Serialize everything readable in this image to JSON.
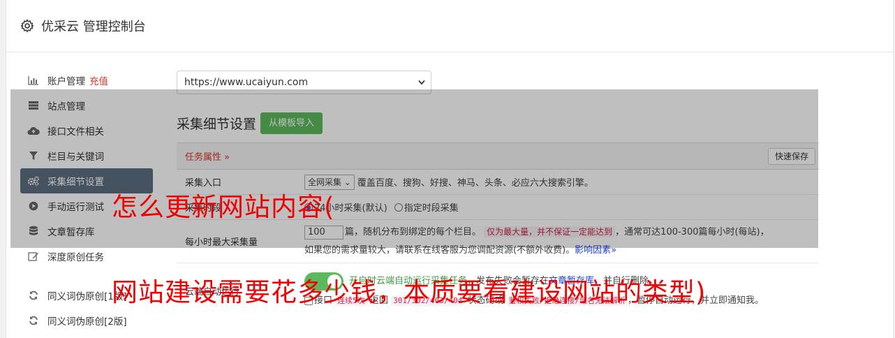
{
  "header": {
    "title": "优采云 管理控制台",
    "icon": "gear-icon"
  },
  "sidebar": {
    "items": [
      {
        "label": "账户管理",
        "badge": "充值",
        "icon": "bar-chart-icon"
      },
      {
        "label": "站点管理",
        "icon": "server-icon"
      },
      {
        "label": "接口文件相关",
        "icon": "cloud-upload-icon"
      },
      {
        "label": "栏目与关键词",
        "icon": "filter-icon"
      },
      {
        "label": "采集细节设置",
        "icon": "cogs-icon",
        "active": true
      },
      {
        "label": "手动运行测试",
        "icon": "play-circle-icon"
      },
      {
        "label": "文章暂存库",
        "icon": "database-icon"
      },
      {
        "label": "深度原创任务",
        "icon": "edit-icon"
      },
      {
        "label": "同义词伪原创[1版]",
        "icon": "refresh-icon"
      },
      {
        "label": "同义词伪原创[2版]",
        "icon": "refresh-icon"
      }
    ]
  },
  "main": {
    "site_url": "https://www.ucaiyun.com",
    "section_title": "采集细节设置",
    "import_button": "从模板导入",
    "task_attr": "任务属性 »",
    "quick_save": "快速保存",
    "rows": {
      "entry": {
        "label": "采集入口",
        "select": "全网采集",
        "desc": "覆盖百度、搜狗、好搜、神马、头条、必应六大搜索引擎。"
      },
      "time": {
        "label": "采集时段",
        "opt1": "24小时采集(默认)",
        "opt2": "指定时段采集"
      },
      "max": {
        "label": "每小时最大采集量",
        "value": "100",
        "text1": "篇，随机分布到绑定的每个栏目。",
        "tag": "仅为最大量，并不保证一定能达到",
        "text2": "，通常可达100-300篇每小时(每站)，",
        "text3": "如果您的需求量较大，请联系在线客服为您调配资源(不额外收费)。",
        "link": "影响因素»"
      },
      "cloud": {
        "label": "云端自动运行",
        "on_text": "开启时云端自动运行采集任务",
        "text_mid": "，发布失败会暂存在",
        "link": "文章暂存库",
        "text_end": "，并自行删除。",
        "check_label": "接口",
        "code1": "连续5次",
        "t1": "返回",
        "code2": "301/302/403/404",
        "t2": "状态码或",
        "code3": "鉴权失败/拒绝连接/域名无法解析",
        "t3": "，暂停自动运行，并立即通知我。"
      }
    }
  },
  "captions": {
    "line1": "怎么更新网站内容(",
    "line2": "网站建设需要花多少钱，本质要看建设网站的类型)"
  },
  "colors": {
    "accent_green": "#5cb85c",
    "active_item": "#5c6f80",
    "red": "#d9362b",
    "caption_red": "#f00000"
  }
}
